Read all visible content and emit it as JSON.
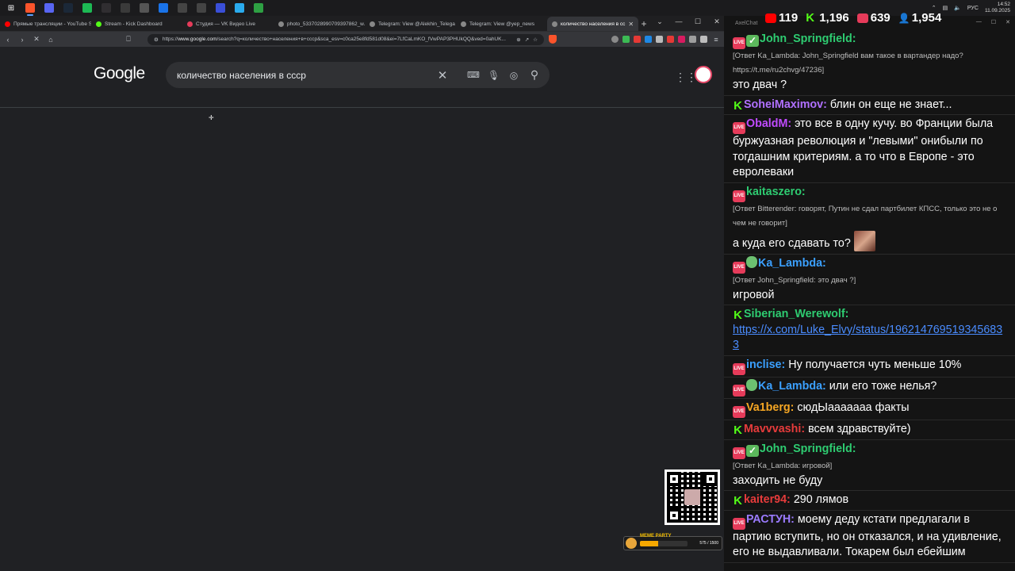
{
  "taskbar": {
    "icons": [
      {
        "name": "windows-start-icon",
        "color": "#3b82f6"
      },
      {
        "name": "brave-browser-icon",
        "color": "#fb542b"
      },
      {
        "name": "chat-app-icon",
        "color": "#5865f2"
      },
      {
        "name": "steam-icon",
        "color": "#1b2838"
      },
      {
        "name": "spotify-icon",
        "color": "#1db954"
      },
      {
        "name": "obs-icon",
        "color": "#302e31"
      },
      {
        "name": "app-circle-icon",
        "color": "#3a3a3a"
      },
      {
        "name": "close-x-app-icon",
        "color": "#555555"
      },
      {
        "name": "blue-app-icon",
        "color": "#1a73e8"
      },
      {
        "name": "clapper-icon",
        "color": "#444444"
      },
      {
        "name": "clapper-2-icon",
        "color": "#444444"
      },
      {
        "name": "play-app-icon",
        "color": "#3a4fd8"
      },
      {
        "name": "telegram-icon",
        "color": "#2aabee"
      },
      {
        "name": "green-app-icon",
        "color": "#2ea043"
      }
    ],
    "tray": {
      "lang": "РУС",
      "time": "14:52",
      "date": "11.09.2025"
    }
  },
  "browser": {
    "tabs": [
      {
        "label": "Прямые трансляции - YouTube Stu",
        "color": "#ff0000"
      },
      {
        "label": "Stream - Kick Dashboard",
        "color": "#53fc18"
      },
      {
        "label": "Студия — VK Видео Live",
        "color": "#e63b5a"
      },
      {
        "label": "photo_5337028990709397862_w.jp",
        "color": "#888888"
      },
      {
        "label": "Telegram: View @Alekhin_Telega",
        "color": "#888888"
      },
      {
        "label": "Telegram: View @yep_news",
        "color": "#888888"
      },
      {
        "label": "количество населения в сс",
        "color": "#888888"
      }
    ],
    "url_prefix": "https://",
    "url_host": "www.google.com",
    "url_rest": "/search?q=количество+населения+в+ссср&sca_esv=c0ca25e8fd581d08&ei=7LfCaLmKO_fVwPAP3PHUkQQ&ved=0ahUK..."
  },
  "google": {
    "logo": "Google",
    "query": "количество населения в ссср"
  },
  "meme_party": {
    "label": "MEME PARTY",
    "count": "575 / 1500",
    "progress": 0.38
  },
  "chat": {
    "window_title": "AxelChat",
    "stats": [
      {
        "name": "youtube",
        "value": "119",
        "color": "#ff0000"
      },
      {
        "name": "kick",
        "value": "1,196",
        "color": "#53fc18"
      },
      {
        "name": "vk-live",
        "value": "639",
        "color": "#e63b5a"
      },
      {
        "name": "total-viewers",
        "value": "1,954",
        "color": "#4aa8ff"
      }
    ],
    "messages": [
      {
        "badges": [
          "live",
          "check"
        ],
        "user": "John_Springfield:",
        "color": "#2ecc71",
        "reply": "[Ответ Ka_Lambda: John_Springfield вам такое в вартандер надо? https://t.me/ru2chvg/47236]",
        "text": "это двач ?"
      },
      {
        "badges": [
          "kick"
        ],
        "user": "SoheiMaximov:",
        "color": "#b070ff",
        "text": "блин он еще не знает..."
      },
      {
        "badges": [
          "live"
        ],
        "user": "ObaldM:",
        "color": "#c04bff",
        "text": "это все в одну кучу. во Франции была буржуазная революция и \"левыми\" онибыли по тогдашним критериям. а то что в Европе - это евролеваки"
      },
      {
        "badges": [
          "live"
        ],
        "user": "kaitaszero:",
        "color": "#2ecc71",
        "reply": "[Ответ Bitterender: говорят, Путин не сдал партбилет КПСС, только это не о чем не говорит]",
        "text": "а куда его сдавать то?",
        "emote": true
      },
      {
        "badges": [
          "live",
          "shield"
        ],
        "user": "Ka_Lambda:",
        "color": "#3ba0ff",
        "reply": "[Ответ John_Springfield: это двач ?]",
        "text": "игровой"
      },
      {
        "badges": [
          "kick"
        ],
        "user": "Siberian_Werewolf:",
        "color": "#2ecc71",
        "link": "https://x.com/Luke_Elvy/status/1962147695193456833"
      },
      {
        "badges": [
          "live"
        ],
        "user": "inclise:",
        "color": "#3ba0ff",
        "text": "Ну получается чуть меньше 10%"
      },
      {
        "badges": [
          "live",
          "shield"
        ],
        "user": "Ka_Lambda:",
        "color": "#3ba0ff",
        "text": "или его тоже нелья?"
      },
      {
        "badges": [
          "live"
        ],
        "user": "Va1berg:",
        "color": "#f5a623",
        "text": "сюдЫааааааа факты"
      },
      {
        "badges": [
          "kick"
        ],
        "user": "Mavvvashi:",
        "color": "#e63b3b",
        "text": "всем здравствуйте)"
      },
      {
        "badges": [
          "live",
          "check"
        ],
        "user": "John_Springfield:",
        "color": "#2ecc71",
        "reply": "[Ответ Ka_Lambda: игровой]",
        "text": "заходить не буду"
      },
      {
        "badges": [
          "kick"
        ],
        "user": "kaiter94:",
        "color": "#e63b3b",
        "text": "290 лямов"
      },
      {
        "badges": [
          "live"
        ],
        "user": "РАСТУН:",
        "color": "#9b7bff",
        "text": "моему деду кстати предлагали в партию вступить, но он отказался, и на удивление, его не выдавливали. Токарем был ебейшим"
      }
    ]
  }
}
